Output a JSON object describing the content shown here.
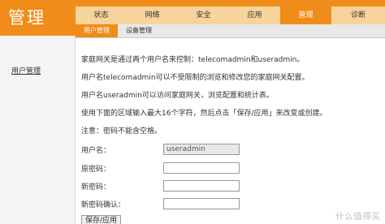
{
  "brand": {
    "title": "管理"
  },
  "topnav": {
    "tabs": [
      {
        "label": "状态"
      },
      {
        "label": "网络"
      },
      {
        "label": "安全"
      },
      {
        "label": "应用"
      },
      {
        "label": "管理"
      },
      {
        "label": "诊断"
      }
    ],
    "active_index": 4
  },
  "subnav": {
    "tabs": [
      {
        "label": "用户管理"
      },
      {
        "label": "设备管理"
      }
    ],
    "active_index": 0
  },
  "sidebar": {
    "items": [
      {
        "label": "用户管理"
      }
    ]
  },
  "main": {
    "paragraphs": [
      "家庭网关是通过两个用户名来控制：telecomadmin和useradmin。",
      "用户名telecomadmin可以不受限制的浏览和修改您的家庭网关配置。",
      "用户名useradmin可以访问家庭网关，浏览配置和统计表。",
      "使用下面的区域输入最大16个字符，然后点击「保存/应用」来改变或创建。",
      "注意：密码不能含空格。"
    ],
    "form": {
      "username_label": "用户名：",
      "username_value": "useradmin",
      "old_password_label": "原密码：",
      "new_password_label": "新密码：",
      "confirm_password_label": "新密码确认："
    },
    "save_button": "保存/应用"
  },
  "watermark": "什么值得买",
  "colors": {
    "accent": "#f08c1a",
    "nav_bg": "#f6d49a",
    "subnav_bg": "#e8e8e8",
    "sidebar_bg": "#f4f4f4"
  }
}
